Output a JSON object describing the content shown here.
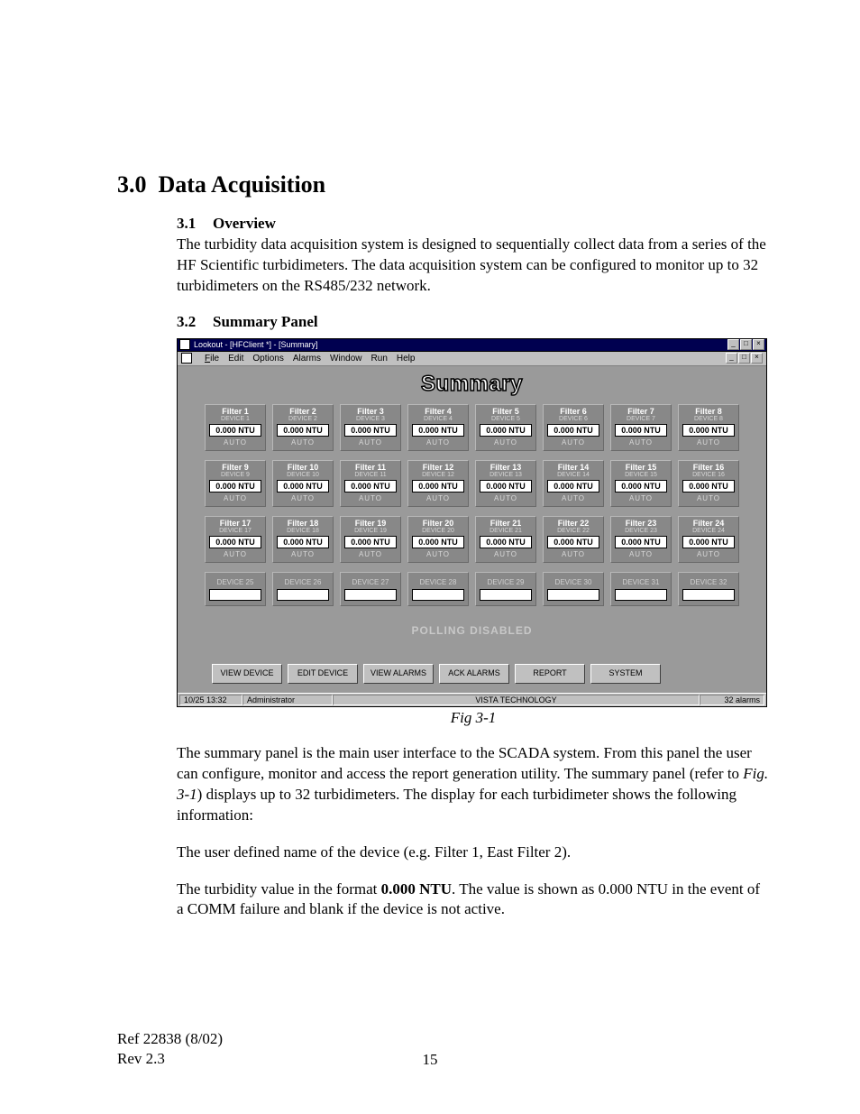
{
  "section": {
    "number": "3.0",
    "title": "Data Acquisition"
  },
  "subsection1": {
    "number": "3.1",
    "title": "Overview",
    "text": "The turbidity data acquisition system is designed to sequentially collect data from a series of the HF Scientific turbidimeters. The data acquisition system can be configured to monitor up to 32 turbidimeters on the RS485/232 network."
  },
  "subsection2": {
    "number": "3.2",
    "title": "Summary Panel"
  },
  "screenshot": {
    "outer_title": "Lookout - [HFClient *] - [Summary]",
    "menu": [
      "File",
      "Edit",
      "Options",
      "Alarms",
      "Window",
      "Run",
      "Help"
    ],
    "panel_title": "Summary",
    "devices": [
      {
        "name": "Filter 1",
        "id": "DEVICE 1",
        "value": "0.000 NTU",
        "mode": "AUTO"
      },
      {
        "name": "Filter 2",
        "id": "DEVICE 2",
        "value": "0.000 NTU",
        "mode": "AUTO"
      },
      {
        "name": "Filter 3",
        "id": "DEVICE 3",
        "value": "0.000 NTU",
        "mode": "AUTO"
      },
      {
        "name": "Filter 4",
        "id": "DEVICE 4",
        "value": "0.000 NTU",
        "mode": "AUTO"
      },
      {
        "name": "Filter 5",
        "id": "DEVICE 5",
        "value": "0.000 NTU",
        "mode": "AUTO"
      },
      {
        "name": "Filter 6",
        "id": "DEVICE 6",
        "value": "0.000 NTU",
        "mode": "AUTO"
      },
      {
        "name": "Filter 7",
        "id": "DEVICE 7",
        "value": "0.000 NTU",
        "mode": "AUTO"
      },
      {
        "name": "Filter 8",
        "id": "DEVICE 8",
        "value": "0.000 NTU",
        "mode": "AUTO"
      },
      {
        "name": "Filter 9",
        "id": "DEVICE 9",
        "value": "0.000 NTU",
        "mode": "AUTO"
      },
      {
        "name": "Filter 10",
        "id": "DEVICE 10",
        "value": "0.000 NTU",
        "mode": "AUTO"
      },
      {
        "name": "Filter 11",
        "id": "DEVICE 11",
        "value": "0.000 NTU",
        "mode": "AUTO"
      },
      {
        "name": "Filter 12",
        "id": "DEVICE 12",
        "value": "0.000 NTU",
        "mode": "AUTO"
      },
      {
        "name": "Filter 13",
        "id": "DEVICE 13",
        "value": "0.000 NTU",
        "mode": "AUTO"
      },
      {
        "name": "Filter 14",
        "id": "DEVICE 14",
        "value": "0.000 NTU",
        "mode": "AUTO"
      },
      {
        "name": "Filter 15",
        "id": "DEVICE 15",
        "value": "0.000 NTU",
        "mode": "AUTO"
      },
      {
        "name": "Filter 16",
        "id": "DEVICE 16",
        "value": "0.000 NTU",
        "mode": "AUTO"
      },
      {
        "name": "Filter 17",
        "id": "DEVICE 17",
        "value": "0.000 NTU",
        "mode": "AUTO"
      },
      {
        "name": "Filter 18",
        "id": "DEVICE 18",
        "value": "0.000 NTU",
        "mode": "AUTO"
      },
      {
        "name": "Filter 19",
        "id": "DEVICE 19",
        "value": "0.000 NTU",
        "mode": "AUTO"
      },
      {
        "name": "Filter 20",
        "id": "DEVICE 20",
        "value": "0.000 NTU",
        "mode": "AUTO"
      },
      {
        "name": "Filter 21",
        "id": "DEVICE 21",
        "value": "0.000 NTU",
        "mode": "AUTO"
      },
      {
        "name": "Filter 22",
        "id": "DEVICE 22",
        "value": "0.000 NTU",
        "mode": "AUTO"
      },
      {
        "name": "Filter 23",
        "id": "DEVICE 23",
        "value": "0.000 NTU",
        "mode": "AUTO"
      },
      {
        "name": "Filter 24",
        "id": "DEVICE 24",
        "value": "0.000 NTU",
        "mode": "AUTO"
      }
    ],
    "inactive": [
      {
        "id": "DEVICE 25"
      },
      {
        "id": "DEVICE 26"
      },
      {
        "id": "DEVICE 27"
      },
      {
        "id": "DEVICE 28"
      },
      {
        "id": "DEVICE 29"
      },
      {
        "id": "DEVICE 30"
      },
      {
        "id": "DEVICE 31"
      },
      {
        "id": "DEVICE 32"
      }
    ],
    "polling": "POLLING DISABLED",
    "buttons": [
      "VIEW DEVICE",
      "EDIT DEVICE",
      "VIEW ALARMS",
      "ACK ALARMS",
      "REPORT",
      "SYSTEM"
    ],
    "status": {
      "time": "10/25 13:32",
      "user": "Administrator",
      "company": "VISTA TECHNOLOGY",
      "alarms": "32 alarms"
    }
  },
  "figure_caption": "Fig 3-1",
  "para1": "The summary panel is the main user interface to the SCADA system. From this panel the user can configure, monitor and access the report generation utility. The summary panel (refer to ",
  "para1_fig": "Fig. 3-1",
  "para1_tail": ") displays up to 32 turbidimeters. The display for each turbidimeter shows the following information:",
  "para2": "The user defined name of the device (e.g. Filter 1, East Filter 2).",
  "para3_lead": "The turbidity value in the format ",
  "para3_bold": "0.000 NTU",
  "para3_tail": ". The value is shown as 0.000 NTU in the event of a COMM failure and blank if the device is not active.",
  "footer": {
    "ref": "Ref 22838 (8/02)",
    "rev": "Rev 2.3",
    "page": "15"
  }
}
